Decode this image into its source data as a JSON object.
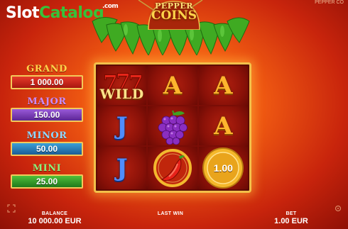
{
  "watermark": {
    "brand_slot": "Slot",
    "brand_catalog": "Catalog",
    "brand_com": ".com"
  },
  "corner_text": "PEPPER CO",
  "logo": {
    "line1": "PEPPER",
    "line2": "COINS"
  },
  "jackpots": [
    {
      "name": "GRAND",
      "value": "1 000.00"
    },
    {
      "name": "MAJOR",
      "value": "150.00"
    },
    {
      "name": "MINOR",
      "value": "50.00"
    },
    {
      "name": "MINI",
      "value": "25.00"
    }
  ],
  "reels": {
    "wild_label": "WILD",
    "cells": {
      "r1c1": "777",
      "r1c2": "A",
      "r1c3": "A",
      "r2c1": "J",
      "r2c2": "grapes-icon",
      "r2c3": "A",
      "r3c1": "J",
      "r3c2": "chili-coin-icon",
      "r3c3": "1.00"
    }
  },
  "bottom": {
    "balance_label": "BALANCE",
    "balance_value": "10 000.00 EUR",
    "lastwin_label": "LAST WIN",
    "bet_label": "BET",
    "bet_value": "1.00 EUR"
  },
  "colors": {
    "frame": "#f2c04a",
    "accent_green": "#36c23a",
    "bg": "#e0440f"
  }
}
